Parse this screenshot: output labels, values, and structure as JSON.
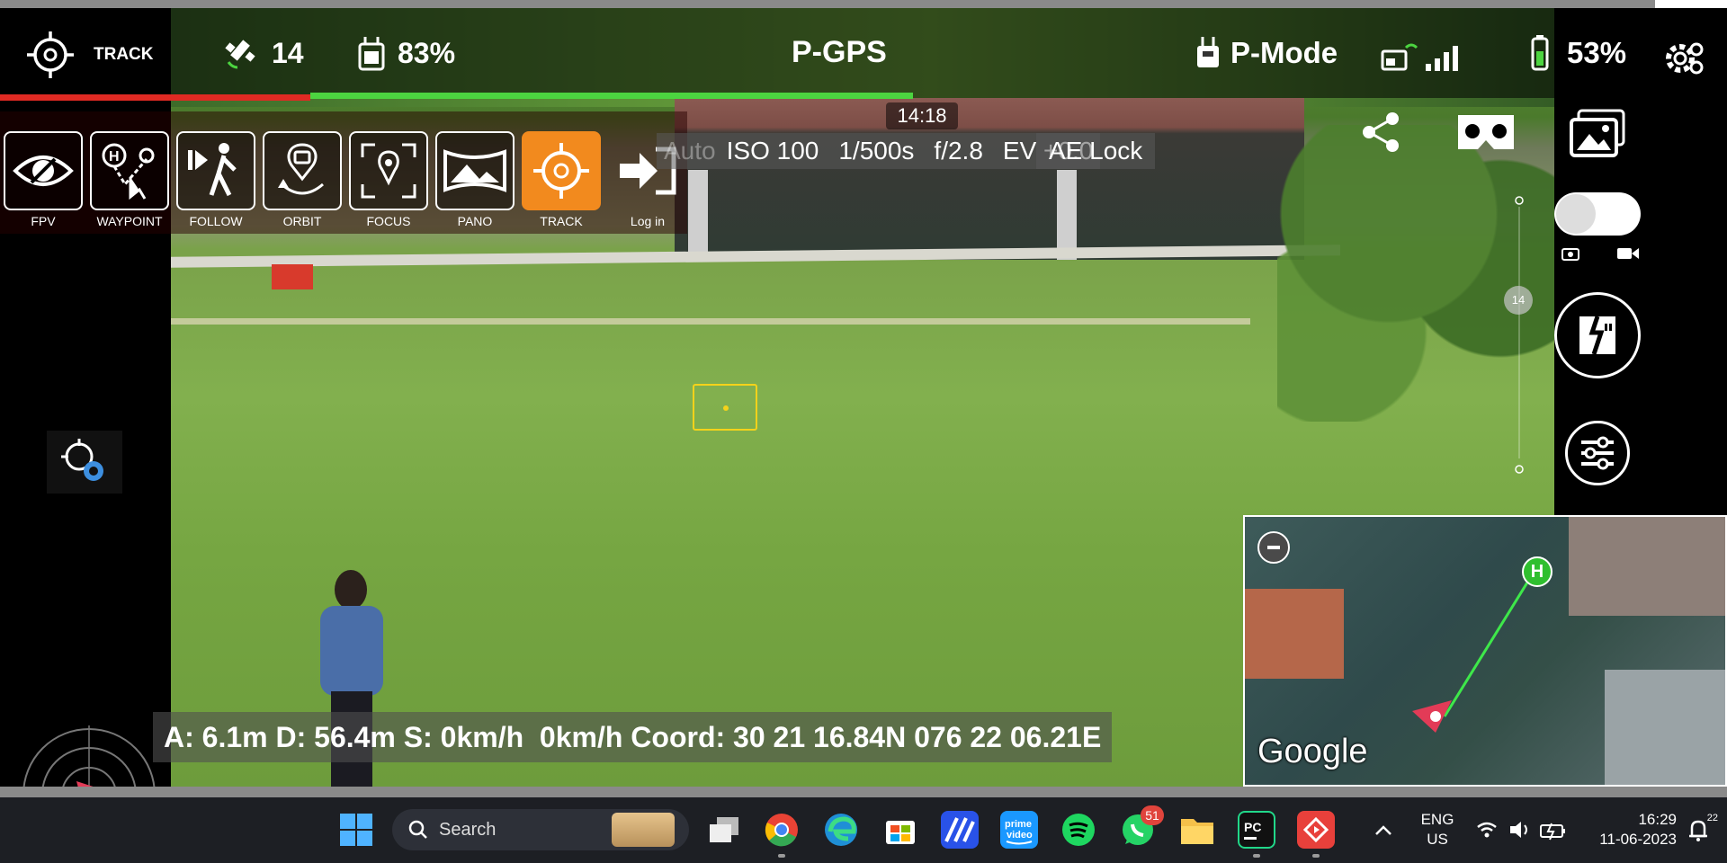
{
  "status_bar": {
    "mode_label": "TRACK",
    "satellites": "14",
    "rc_battery": "83%",
    "gps_mode": "P-GPS",
    "flight_mode": "P-Mode",
    "drone_battery": "53%",
    "flight_time": "14:18"
  },
  "mode_strip": {
    "modes": [
      {
        "label": "FPV",
        "icon": "eye-icon"
      },
      {
        "label": "WAYPOINT",
        "icon": "waypoint-icon"
      },
      {
        "label": "FOLLOW",
        "icon": "follow-icon"
      },
      {
        "label": "ORBIT",
        "icon": "orbit-icon"
      },
      {
        "label": "FOCUS",
        "icon": "focus-icon"
      },
      {
        "label": "PANO",
        "icon": "pano-icon"
      },
      {
        "label": "TRACK",
        "icon": "track-icon"
      },
      {
        "label": "Log in",
        "icon": "login-icon"
      }
    ],
    "active": "TRACK"
  },
  "camera_params": {
    "auto": "Auto",
    "iso": "ISO 100",
    "shutter": "1/500s",
    "aperture": "f/2.8",
    "ev": "EV +0.0",
    "ae_lock": "AE Lock"
  },
  "slider_badge": "14",
  "telemetry": "A: 6.1m D: 56.4m S: 0km/h  0km/h Coord: 30 21 16.84N 076 22 06.21E",
  "minimap": {
    "provider": "Google",
    "home_label": "H"
  },
  "taskbar": {
    "search_placeholder": "Search",
    "whatsapp_badge": "51",
    "language_top": "ENG",
    "language_bottom": "US",
    "time": "16:29",
    "date": "11-06-2023",
    "notification_count": "22"
  },
  "colors": {
    "accent_orange": "#f28a1e",
    "progress_red": "#e02a23",
    "progress_green": "#4cd440",
    "focus_yellow": "#f4d21a"
  }
}
